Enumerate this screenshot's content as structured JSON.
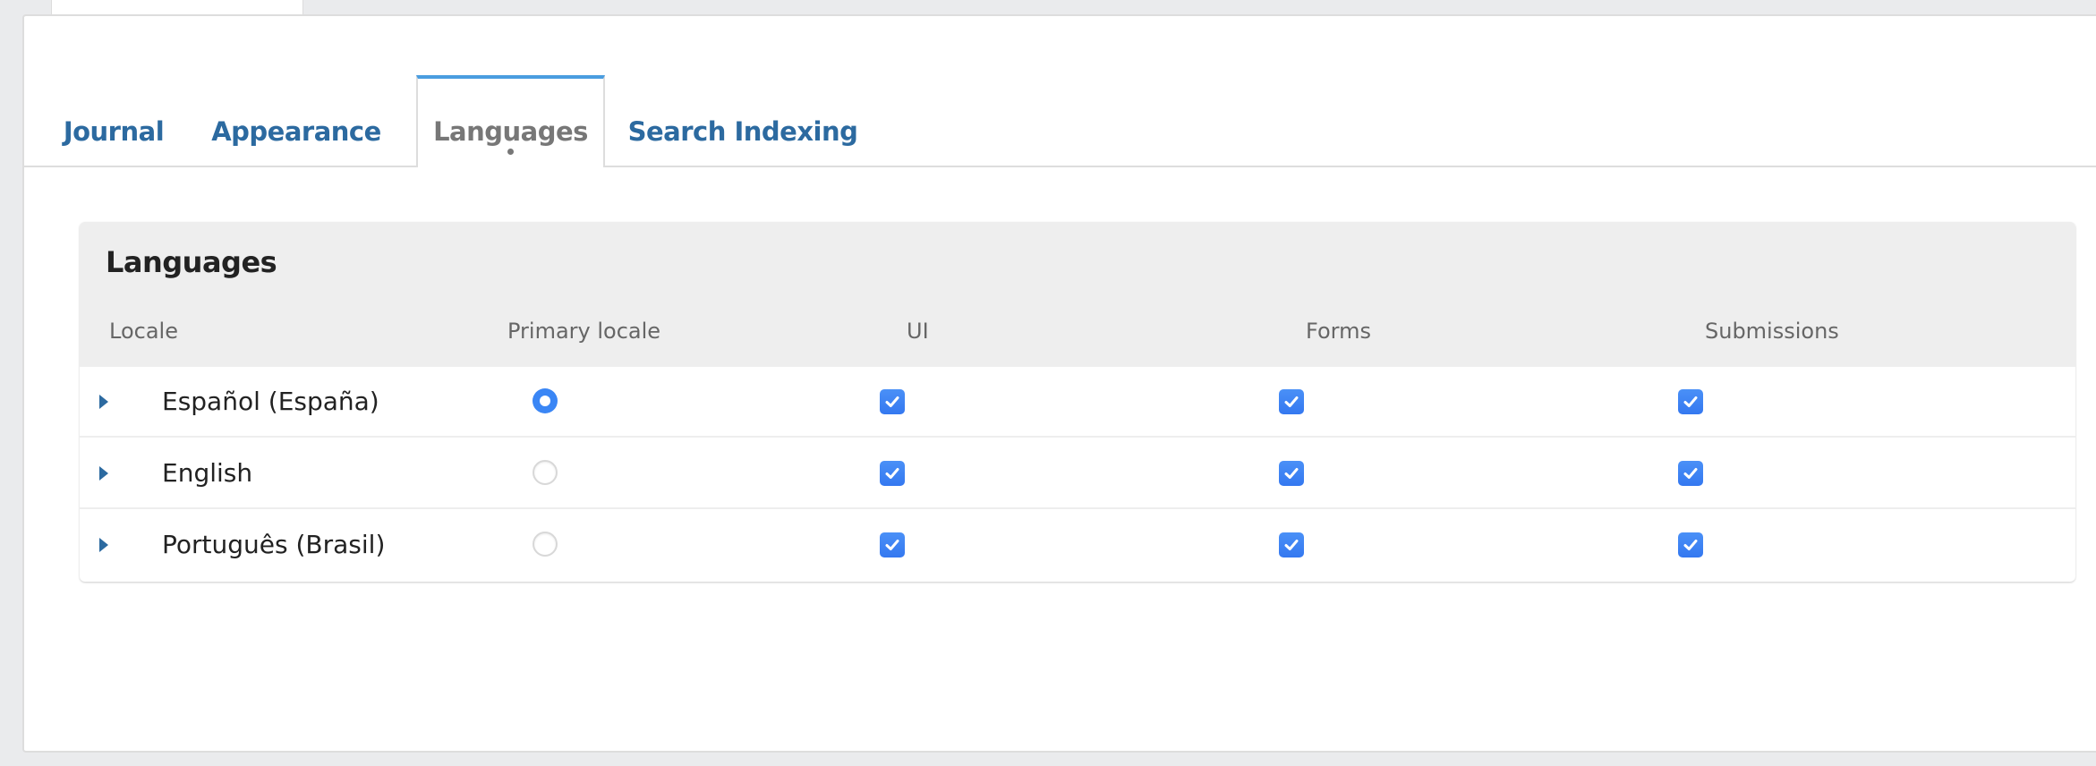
{
  "top_tab": {
    "label": ""
  },
  "tabs": [
    {
      "label": "Journal",
      "active": false
    },
    {
      "label": "Appearance",
      "active": false
    },
    {
      "label": "Languages",
      "active": true
    },
    {
      "label": "Search Indexing",
      "active": false
    }
  ],
  "languages": {
    "title": "Languages",
    "columns": [
      "Locale",
      "Primary locale",
      "UI",
      "Forms",
      "Submissions"
    ],
    "rows": [
      {
        "locale": "Español (España)",
        "primary": true,
        "ui": true,
        "forms": true,
        "submissions": true
      },
      {
        "locale": "English",
        "primary": false,
        "ui": true,
        "forms": true,
        "submissions": true
      },
      {
        "locale": "Português (Brasil)",
        "primary": false,
        "ui": true,
        "forms": true,
        "submissions": true
      }
    ]
  },
  "colors": {
    "link": "#2c6aa0",
    "active_tab_border": "#4a9de0",
    "checkbox": "#3a86f5"
  },
  "icons": {
    "expander": "triangle-right-icon",
    "check": "checkmark-icon"
  }
}
